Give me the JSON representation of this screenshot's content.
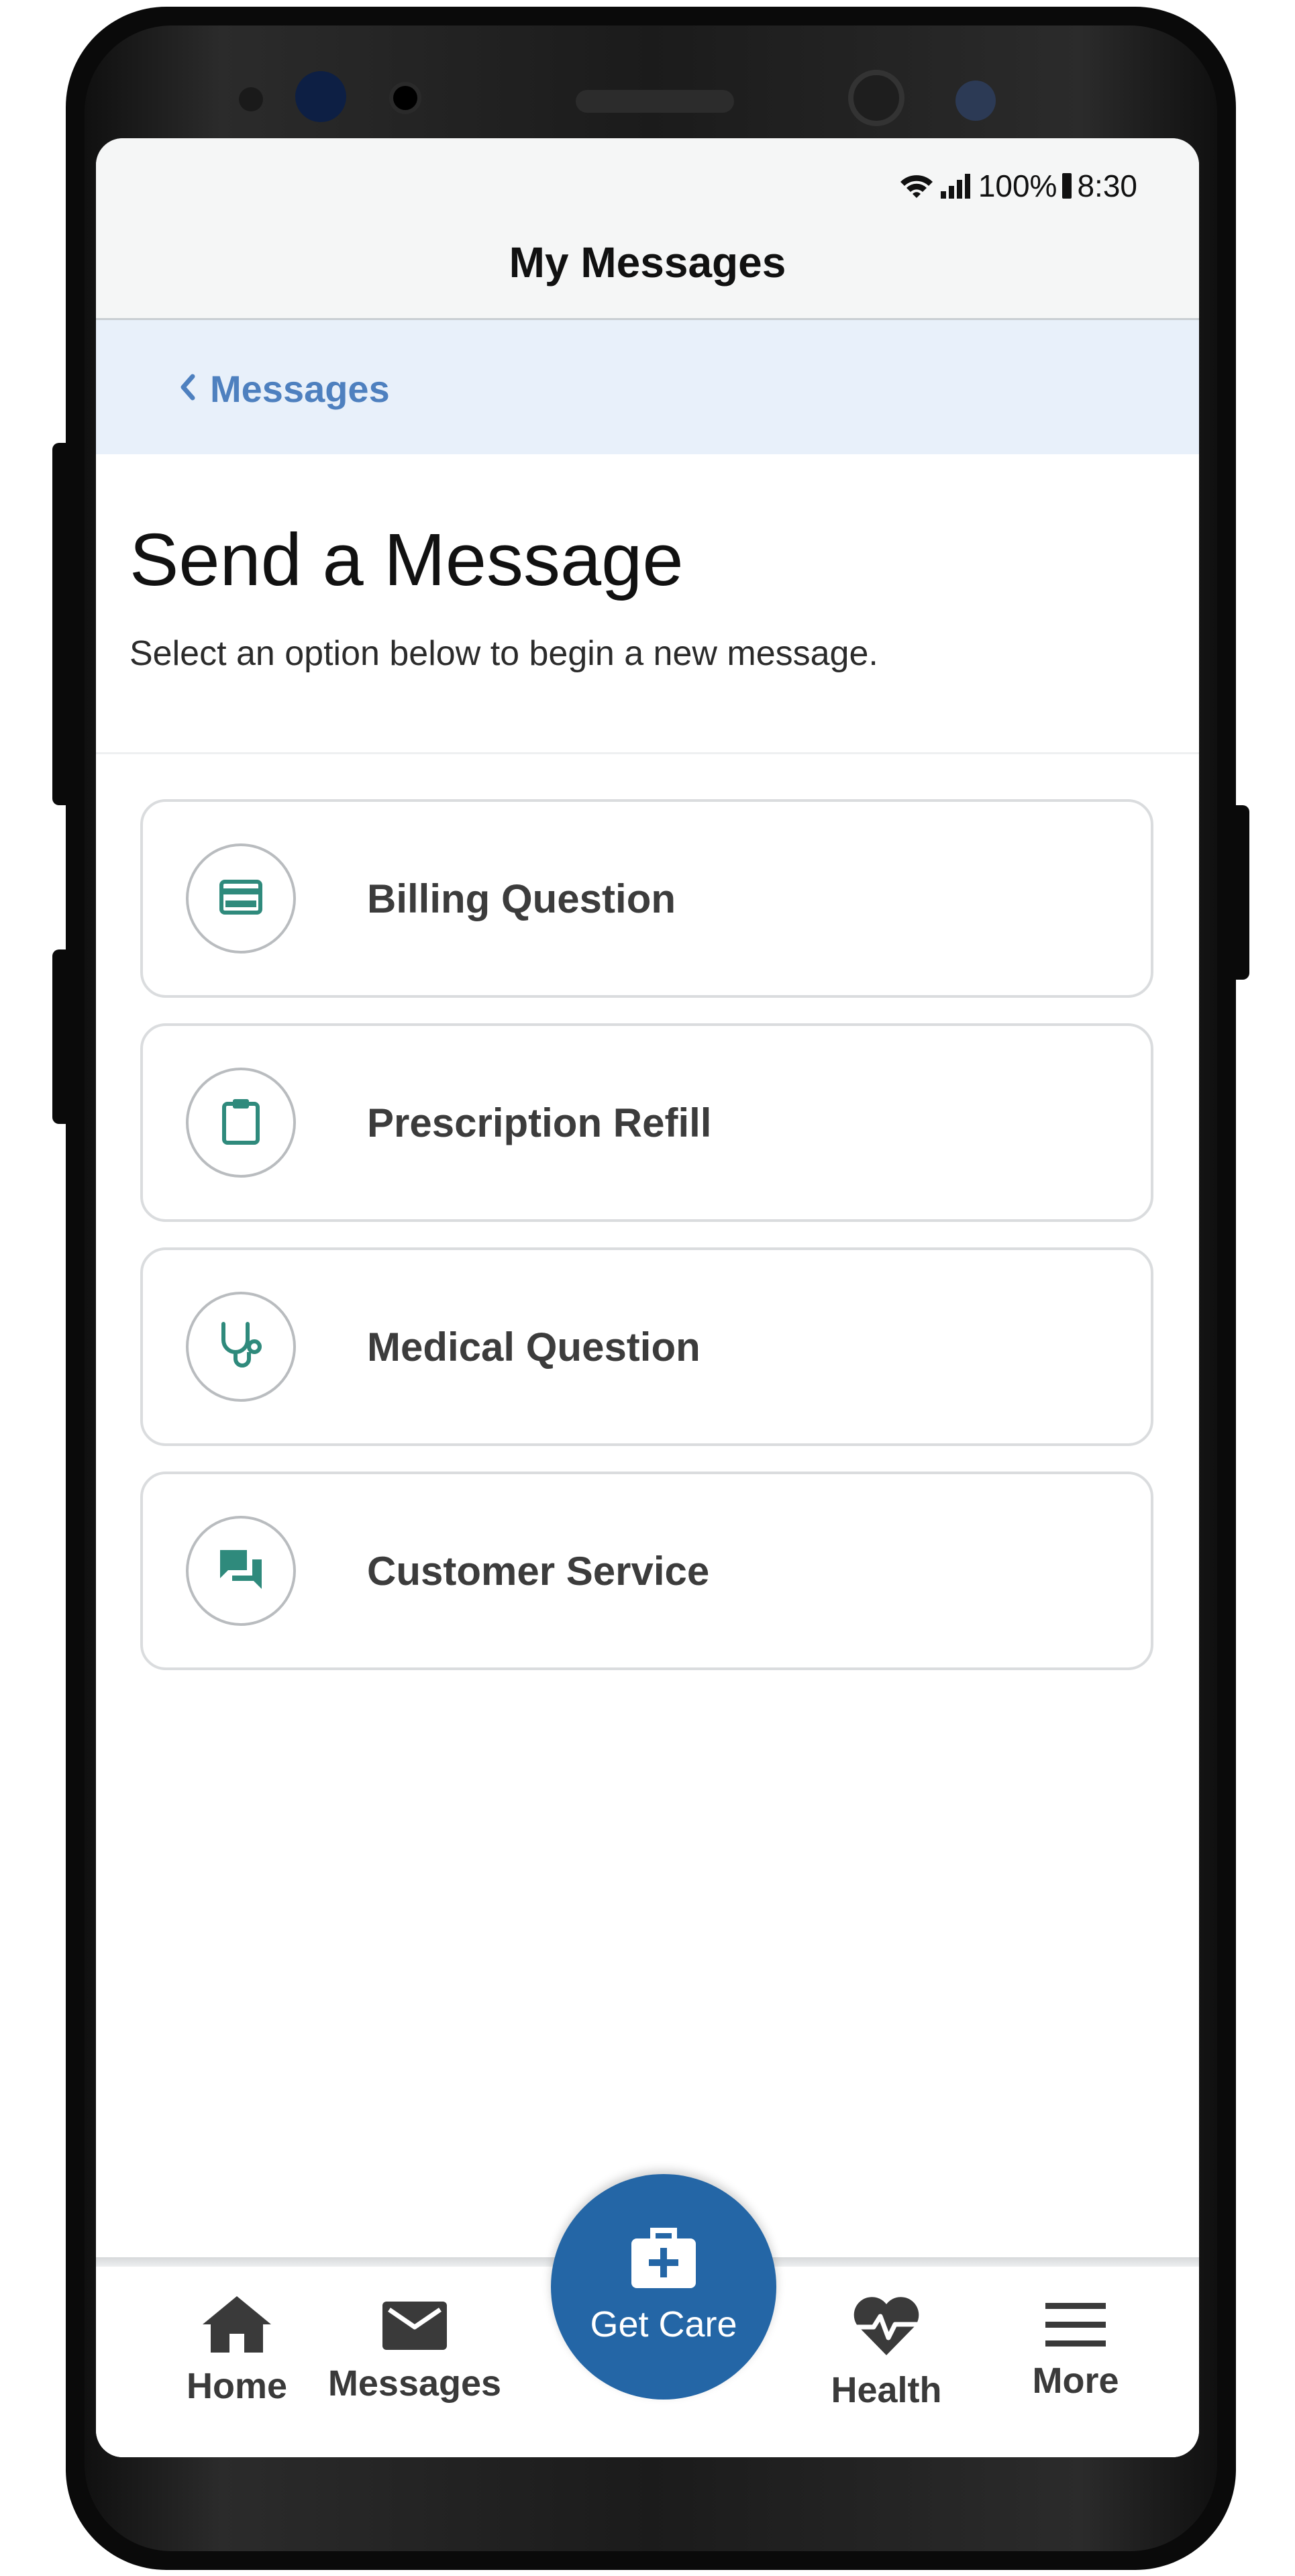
{
  "status_bar": {
    "battery": "100%",
    "time": "8:30"
  },
  "header": {
    "title": "My Messages"
  },
  "back_link": {
    "label": "Messages"
  },
  "page": {
    "title": "Send a Message",
    "subtitle": "Select an option below to begin a new message."
  },
  "options": [
    {
      "label": "Billing Question",
      "icon": "credit-card-icon"
    },
    {
      "label": "Prescription Refill",
      "icon": "clipboard-icon"
    },
    {
      "label": "Medical Question",
      "icon": "stethoscope-icon"
    },
    {
      "label": "Customer Service",
      "icon": "chat-bubbles-icon"
    }
  ],
  "tab_bar": {
    "home": "Home",
    "messages": "Messages",
    "get_care": "Get Care",
    "health": "Health",
    "more": "More"
  },
  "colors": {
    "accent": "#2466a6",
    "link": "#4e80bf",
    "icon_teal": "#2f8a7c",
    "back_bar_bg": "#e8f0fa"
  }
}
